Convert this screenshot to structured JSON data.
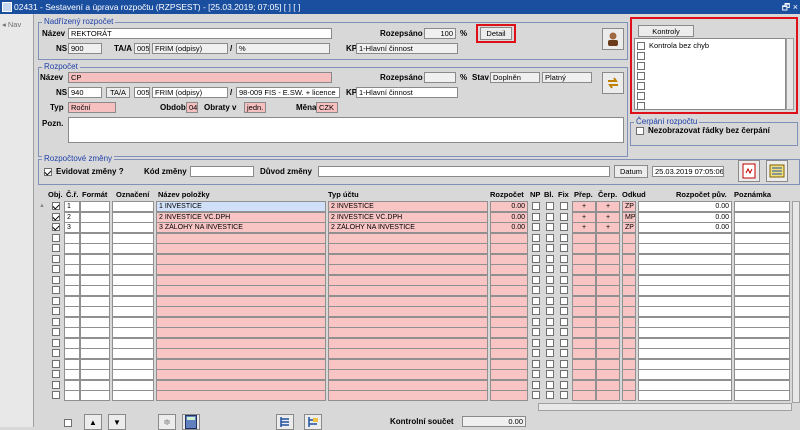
{
  "window": {
    "title": "02431 - Sestavení a úprava rozpočtu (RZPSEST) - [25.03.2019; 07:05] [ ] [ ]",
    "controls": "🗗 ×"
  },
  "sidebar": {
    "nav": "Nav"
  },
  "parent_budget": {
    "title": "Nadřízený rozpočet",
    "name_label": "Název",
    "name_value": "REKTORÁT",
    "rozpesano_label": "Rozepsáno",
    "rozpesano_value": "100",
    "percent": "%",
    "detail_button": "Detail",
    "ns_label": "NS",
    "ns_value": "900",
    "taa_label": "TA/A",
    "taa_code": "005",
    "taa_text": "FRIM (odpisy)",
    "slash": "/",
    "slash_value": "%",
    "kp_label": "KP",
    "kp_value": "1-Hlavní činnost"
  },
  "controls_panel": {
    "title": "Kontroly",
    "items": [
      "Kontrola bez chyb",
      "",
      "",
      "",
      "",
      "",
      ""
    ]
  },
  "budget": {
    "title": "Rozpočet",
    "name_label": "Název",
    "name_value": "CP",
    "rozpesano_label": "Rozepsáno",
    "percent": "%",
    "stav_label": "Stav",
    "stav_value1": "Doplněn",
    "stav_value2": "Platný",
    "ns_label": "NS",
    "ns_value": "940",
    "taa_button": "TA/A",
    "taa_code": "005",
    "taa_text": "FRIM (odpisy)",
    "slash": "/",
    "slash_value": "98-009 FIS - E.SW. + licence",
    "kp_label": "KP",
    "kp_value": "1-Hlavní činnost",
    "typ_label": "Typ",
    "typ_value": "Roční",
    "obdobi_label": "Období",
    "obdobi_value": "04",
    "obraty_label": "Obraty v",
    "obraty_value": "jedn.",
    "mena_label": "Měna",
    "mena_value": "CZK",
    "pozn_label": "Pozn."
  },
  "cerpani": {
    "title": "Čerpání rozpočtu",
    "checkbox_label": "Nezobrazovat řádky bez čerpání"
  },
  "changes": {
    "title": "Rozpočtové změny",
    "evidovat_label": "Evidovat změny ?",
    "kod_label": "Kód změny",
    "duvod_label": "Důvod změny",
    "datum_button": "Datum",
    "datum_value": "25.03.2019 07:05:06"
  },
  "table": {
    "headers": {
      "obj": "Obj.",
      "cr": "Č.ř.",
      "format": "Formát",
      "oznaceni": "Označení",
      "nazev": "Název položky",
      "typ": "Typ účtu",
      "rozpocet": "Rozpočet",
      "np": "NP",
      "bl": "Bl.",
      "fix": "Fix",
      "prep": "Přep.",
      "cerp": "Čerp.",
      "odkud": "Odkud",
      "rozpocet_puv": "Rozpočet pův.",
      "poznamka": "Poznámka"
    },
    "rows": [
      {
        "cr": "1",
        "nazev": "1 INVESTICE",
        "typ": "2 INVESTICE",
        "rozpocet": "0.00",
        "prep": "+",
        "cerp": "+",
        "odkud": "ZP",
        "puv": "0.00"
      },
      {
        "cr": "2",
        "nazev": "2  INVESTICE VČ.DPH",
        "typ": "2 INVESTICE VČ.DPH",
        "rozpocet": "0.00",
        "prep": "+",
        "cerp": "+",
        "odkud": "MP",
        "puv": "0.00"
      },
      {
        "cr": "3",
        "nazev": "3  ZÁLOHY NA INVESTICE",
        "typ": "2 ZÁLOHY NA INVESTICE",
        "rozpocet": "0.00",
        "prep": "+",
        "cerp": "+",
        "odkud": "ZP",
        "puv": "0.00"
      }
    ],
    "empty_rows": 16
  },
  "footer": {
    "kontrolni_label": "Kontrolní součet",
    "kontrolni_value": "0.00"
  }
}
